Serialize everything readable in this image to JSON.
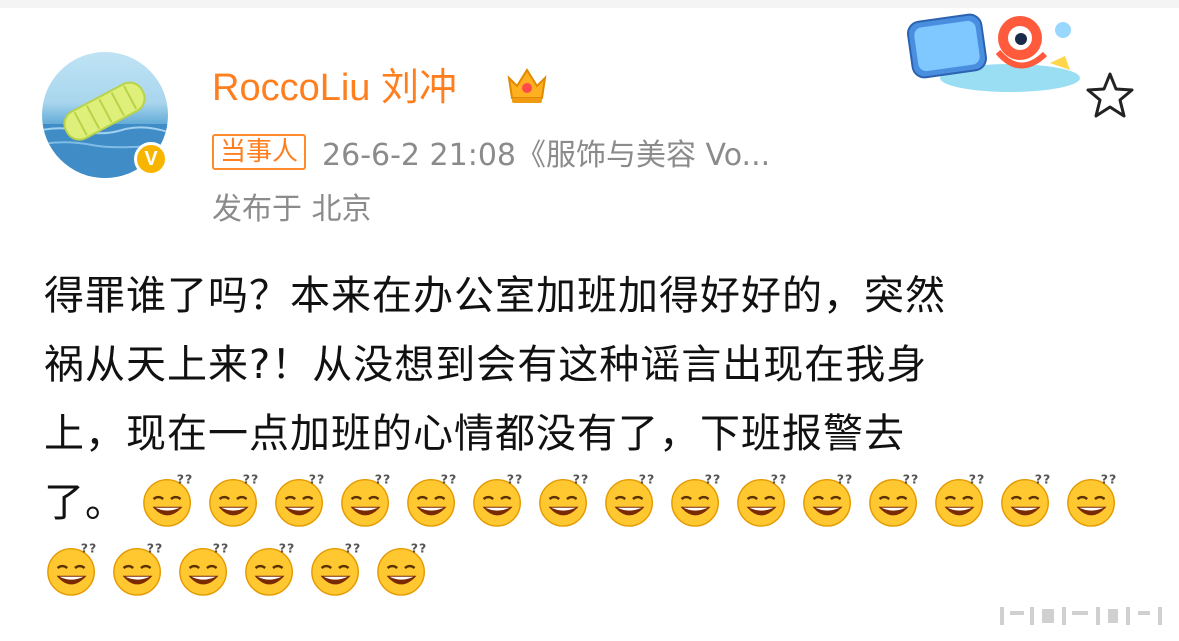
{
  "post": {
    "author": {
      "name": "RoccoLiu 刘冲",
      "verified_badge": "V",
      "crown_icon": "crown-icon",
      "avatar_icon": "pool-float-avatar"
    },
    "party_badge": "当事人",
    "meta": "26-6-2 21:08《服饰与美容 Vo...",
    "location": "发布于 北京",
    "promo_icon": "national-day-film-critic-badge",
    "favorite_icon": "star-outline-icon",
    "body_lines": [
      "得罪谁了吗？本来在办公室加班加得好好的，突然",
      "祸从天上来?！从没想到会有这种谣言出现在我身",
      "上，现在一点加班的心情都没有了，下班报警去",
      "了。"
    ],
    "emoji": {
      "name": "dizzy-grin-emoji",
      "count": 21,
      "per_first_row": 15
    }
  },
  "colors": {
    "accent": "#ff7f1f",
    "meta_gray": "#8b8b8b",
    "body_text": "#111111",
    "emoji_yellow": "#ffc830"
  }
}
